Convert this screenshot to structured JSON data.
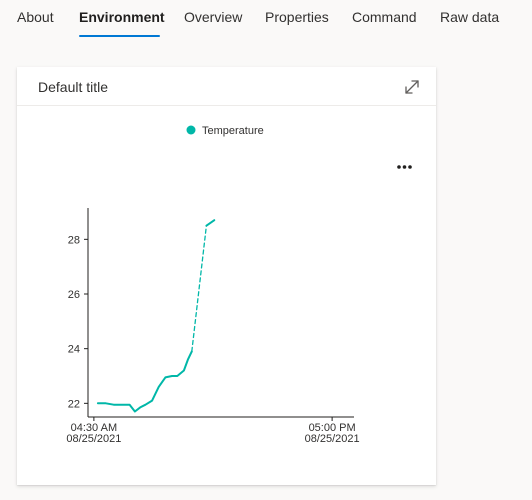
{
  "tabs": [
    {
      "label": "About",
      "active": false
    },
    {
      "label": "Environment",
      "active": true
    },
    {
      "label": "Overview",
      "active": false
    },
    {
      "label": "Properties",
      "active": false
    },
    {
      "label": "Command",
      "active": false
    },
    {
      "label": "Raw data",
      "active": false
    }
  ],
  "card": {
    "title": "Default title",
    "expand_icon": "expand-diagonal-icon",
    "more_icon": "more-horizontal-icon"
  },
  "colors": {
    "accent": "#0078d4",
    "series": "#00b7a8"
  },
  "chart_data": {
    "type": "line",
    "title": "",
    "xlabel": "",
    "ylabel": "",
    "legend": {
      "position": "top-center"
    },
    "grid": false,
    "ylim": [
      21.5,
      29
    ],
    "xlim": [
      "2021-08-25 04:28",
      "2021-08-25 05:02"
    ],
    "yticks": [
      22,
      24,
      26,
      28
    ],
    "xticks": [
      {
        "time": "04:30 AM",
        "date": "08/25/2021",
        "value": "2021-08-25 04:30"
      },
      {
        "time": "05:00 PM",
        "date": "08/25/2021",
        "value": "2021-08-25 05:00"
      }
    ],
    "series": [
      {
        "name": "Temperature",
        "color": "#00b7a8",
        "segments": [
          {
            "style": "solid",
            "x": [
              "2021-08-25 04:30:30",
              "2021-08-25 04:31:30",
              "2021-08-25 04:32:30",
              "2021-08-25 04:33:30",
              "2021-08-25 04:34:30",
              "2021-08-25 04:35:10",
              "2021-08-25 04:35:50",
              "2021-08-25 04:36:30",
              "2021-08-25 04:37:20",
              "2021-08-25 04:38:10",
              "2021-08-25 04:39:00",
              "2021-08-25 04:39:50",
              "2021-08-25 04:40:30",
              "2021-08-25 04:41:20",
              "2021-08-25 04:41:50",
              "2021-08-25 04:42:20"
            ],
            "y": [
              22.0,
              22.0,
              21.95,
              21.95,
              21.95,
              21.7,
              21.85,
              21.95,
              22.1,
              22.6,
              22.95,
              23.0,
              23.0,
              23.2,
              23.6,
              23.9
            ]
          },
          {
            "style": "dashed",
            "x": [
              "2021-08-25 04:42:20",
              "2021-08-25 04:44:10"
            ],
            "y": [
              23.9,
              28.5
            ]
          },
          {
            "style": "solid",
            "x": [
              "2021-08-25 04:44:10",
              "2021-08-25 04:45:10"
            ],
            "y": [
              28.5,
              28.7
            ]
          }
        ]
      }
    ]
  }
}
